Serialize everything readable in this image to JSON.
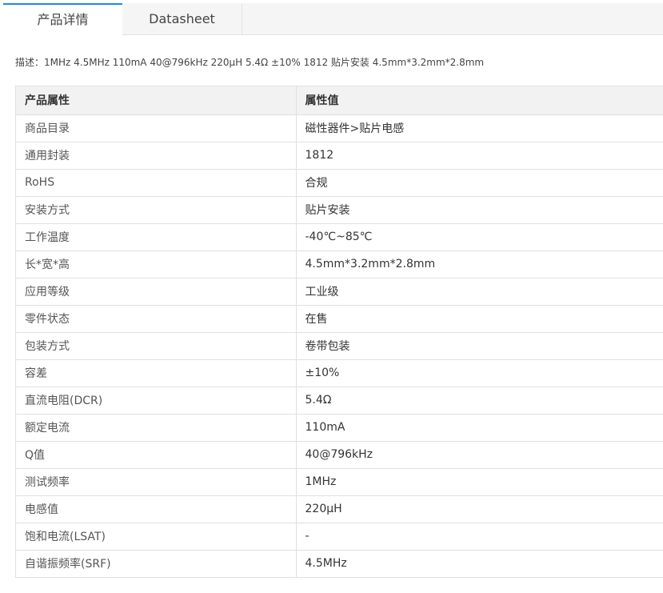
{
  "tabs": [
    {
      "label": "产品详情",
      "active": true
    },
    {
      "label": "Datasheet",
      "active": false
    }
  ],
  "description": "描述：1MHz 4.5MHz 110mA 40@796kHz 220μH 5.4Ω ±10% 1812 贴片安装 4.5mm*3.2mm*2.8mm",
  "table": {
    "headers": [
      "产品属性",
      "属性值"
    ],
    "rows": [
      [
        "商品目录",
        "磁性器件>贴片电感"
      ],
      [
        "通用封装",
        "1812"
      ],
      [
        "RoHS",
        "合规"
      ],
      [
        "安装方式",
        "贴片安装"
      ],
      [
        "工作温度",
        "-40℃~85℃"
      ],
      [
        "长*宽*高",
        "4.5mm*3.2mm*2.8mm"
      ],
      [
        "应用等级",
        "工业级"
      ],
      [
        "零件状态",
        "在售"
      ],
      [
        "包装方式",
        "卷带包装"
      ],
      [
        "容差",
        "±10%"
      ],
      [
        "直流电阻(DCR)",
        "5.4Ω"
      ],
      [
        "额定电流",
        "110mA"
      ],
      [
        "Q值",
        "40@796kHz"
      ],
      [
        "测试频率",
        "1MHz"
      ],
      [
        "电感值",
        "220μH"
      ],
      [
        "饱和电流(LSAT)",
        "-"
      ],
      [
        "自谐振频率(SRF)",
        "4.5MHz"
      ]
    ]
  },
  "colors": {
    "accent": "#1e88e5",
    "header_bg": "#f2f2f2",
    "border": "#e0e0e0"
  }
}
